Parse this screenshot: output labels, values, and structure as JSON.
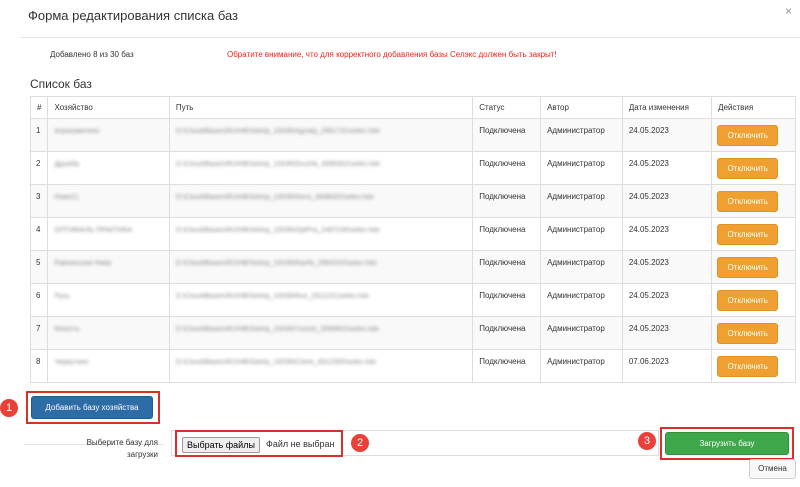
{
  "dialog": {
    "title": "Форма редактирования списка баз",
    "close_glyph": "×"
  },
  "info": {
    "count": "Добавлено 8 из 30 баз",
    "warning": "Обратите внимание, что для корректного добавления базы Селэкс должен быть закрыт!"
  },
  "list": {
    "title": "Список баз",
    "columns": [
      "#",
      "Хозяйство",
      "Путь",
      "Статус",
      "Автор",
      "Дата изменения",
      "Действия"
    ],
    "rows": [
      {
        "num": "1",
        "farm": "Агрокомплекс",
        "path": "D:\\Cloud\\Bases\\RU\\HB\\Selx\\p_10036\\Agrokp_2991731\\selex.hdx",
        "status": "Подключена",
        "author": "Администратор",
        "date": "24.05.2023",
        "action": "Отключить"
      },
      {
        "num": "2",
        "farm": "Дружба",
        "path": "D:\\Cloud\\Bases\\RU\\HB\\Selx\\p_10036\\Druzhb_4999302\\selex.hdx",
        "status": "Подключена",
        "author": "Администратор",
        "date": "24.05.2023",
        "action": "Отключить"
      },
      {
        "num": "3",
        "farm": "Ново21",
        "path": "D:\\Cloud\\Bases\\RU\\HB\\Selx\\p_10036\\Novo_3998002\\selex.hdx",
        "status": "Подключена",
        "author": "Администратор",
        "date": "24.05.2023",
        "action": "Отключить"
      },
      {
        "num": "4",
        "farm": "ОПТИМАЛЬ ПРАКТИКА",
        "path": "D:\\Cloud\\Bases\\RU\\HB\\Selx\\p_10036\\OptPra_2497230\\selex.hdx",
        "status": "Подключена",
        "author": "Администратор",
        "date": "24.05.2023",
        "action": "Отключить"
      },
      {
        "num": "5",
        "farm": "Равнинская Нива",
        "path": "D:\\Cloud\\Bases\\RU\\HB\\Selx\\p_10036\\RavNi_2964320\\selex.hdx",
        "status": "Подключена",
        "author": "Администратор",
        "date": "24.05.2023",
        "action": "Отключить"
      },
      {
        "num": "6",
        "farm": "Русь",
        "path": "D:\\Cloud\\Bases\\RU\\HB\\Selx\\p_10036\\Rus_2911101\\selex.hdx",
        "status": "Подключена",
        "author": "Администратор",
        "date": "24.05.2023",
        "action": "Отключить"
      },
      {
        "num": "7",
        "farm": "Юность",
        "path": "D:\\Cloud\\Bases\\RU\\HB\\Selx\\p_10036\\Yunost_3099902\\selex.hdx",
        "status": "Подключена",
        "author": "Администратор",
        "date": "24.05.2023",
        "action": "Отключить"
      },
      {
        "num": "8",
        "farm": "Черкутино",
        "path": "D:\\Cloud\\Bases\\RU\\HB\\Selx\\p_10036\\Cherk_4912300\\selex.hdx",
        "status": "Подключена",
        "author": "Администратор",
        "date": "07.06.2023",
        "action": "Отключить"
      }
    ]
  },
  "actions": {
    "add_farm_base": "Добавить базу хозяйства",
    "select_label": "Выберите базу для загрузки",
    "file_button": "Выбрать файлы",
    "file_status": "Файл не выбран",
    "upload": "Загрузить базу",
    "cancel": "Отмена"
  },
  "markers": [
    "1",
    "2",
    "3"
  ],
  "colors": {
    "warning_text": "#e8261c",
    "disconnect_button": "#f0a030",
    "add_button": "#2d6ca6",
    "upload_button": "#3da74a",
    "annotation_red": "#d9302c"
  }
}
